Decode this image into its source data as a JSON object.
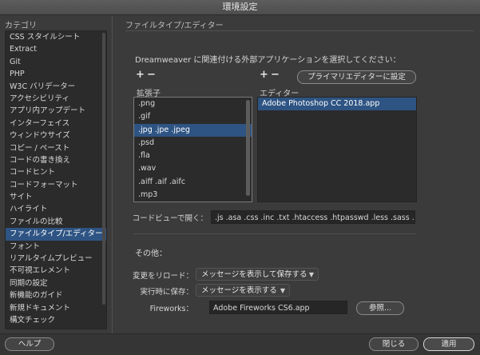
{
  "window": {
    "title": "環境設定"
  },
  "sidebar": {
    "header": "カテゴリ",
    "items": [
      "CSS スタイルシート",
      "Extract",
      "Git",
      "PHP",
      "W3C バリデーター",
      "アクセシビリティ",
      "アプリ内アップデート",
      "インターフェイス",
      "ウィンドウサイズ",
      "コピー / ペースト",
      "コードの書き換え",
      "コードヒント",
      "コードフォーマット",
      "サイト",
      "ハイライト",
      "ファイルの比較",
      "ファイルタイプ/エディター",
      "フォント",
      "リアルタイムプレビュー",
      "不可視エレメント",
      "同期の設定",
      "新機能のガイド",
      "新規ドキュメント",
      "構文チェック"
    ],
    "selected_index": 16
  },
  "panel": {
    "title": "ファイルタイプ/エディター",
    "instruction": "Dreamweaver に関連付ける外部アプリケーションを選択してください：",
    "plus": "+",
    "minus": "−",
    "extensions_header": "拡張子",
    "editors_header": "エディター",
    "primary_editor_button": "プライマリエディターに設定",
    "extensions": [
      ".png",
      ".gif",
      ".jpg .jpe .jpeg",
      ".psd",
      ".fla",
      ".wav",
      ".aiff .aif .aifc",
      ".mp3"
    ],
    "extensions_selected_index": 2,
    "editors": [
      "Adobe Photoshop CC 2018.app"
    ],
    "code_view_label": "コードビューで開く：",
    "code_view_value": ".js .asa .css .inc .txt .htaccess .htpasswd .less .sass .sc",
    "other_header": "その他：",
    "reload_label": "変更をリロード：",
    "reload_value": "メッセージを表示して保存する",
    "save_on_run_label": "実行時に保存：",
    "save_on_run_value": "メッセージを表示する",
    "fireworks_label": "Fireworks：",
    "fireworks_value": "Adobe Fireworks CS6.app",
    "browse_button": "参照..."
  },
  "footer": {
    "help": "ヘルプ",
    "close": "閉じる",
    "apply": "適用"
  }
}
